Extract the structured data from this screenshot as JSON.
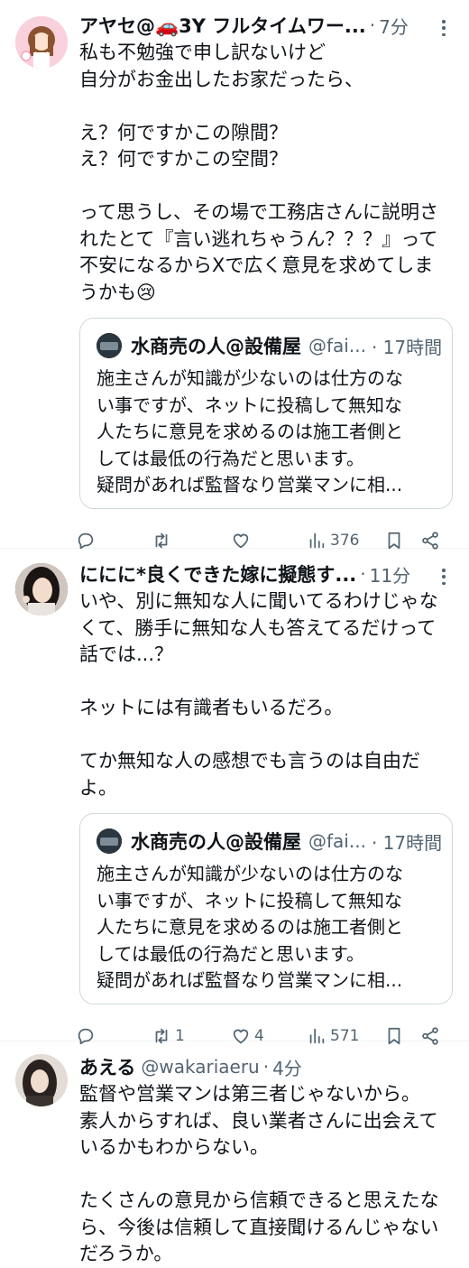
{
  "tweets": [
    {
      "name": "アヤセ@🚗3Y フルタイムワー...",
      "handle": "",
      "dot": "·",
      "time": "7分",
      "text": "私も不勉強で申し訳ないけど\n自分がお金出したお家だったら、\n\nえ？何ですかこの隙間？\nえ？何ですかこの空間？\n\nって思うし、その場で工務店さんに説明さ\nれたとて『言い逃れちゃうん？？？』って\n不安になるからXで広く意見を求めてしま\nうかも😢",
      "quote": {
        "name": "水商売の人@設備屋",
        "handle": "@fai...",
        "time": "· 17時間",
        "text": "施主さんが知識が少ないのは仕方のな\nい事ですが、ネットに投稿して無知な\n人たちに意見を求めるのは施工者側と\nしては最低の行為だと思います。\n疑問があれば監督なり営業マンに相..."
      },
      "actions": {
        "reply": "",
        "retweet": "",
        "like": "",
        "views": "376"
      }
    },
    {
      "name": "ににに*良くできた嫁に擬態す...",
      "handle": "",
      "dot": "·",
      "time": "11分",
      "text": "いや、別に無知な人に聞いてるわけじゃな\nくて、勝手に無知な人も答えてるだけって\n話では...？\n\nネットには有識者もいるだろ。\n\nてか無知な人の感想でも言うのは自由だ\nよ。",
      "quote": {
        "name": "水商売の人@設備屋",
        "handle": "@fai...",
        "time": "· 17時間",
        "text": "施主さんが知識が少ないのは仕方のな\nい事ですが、ネットに投稿して無知な\n人たちに意見を求めるのは施工者側と\nしては最低の行為だと思います。\n疑問があれば監督なり営業マンに相..."
      },
      "actions": {
        "reply": "",
        "retweet": "1",
        "like": "4",
        "views": "571"
      }
    },
    {
      "name": "あえる",
      "handle": "@wakariaeru",
      "dot": "·",
      "time": "4分",
      "text": "監督や営業マンは第三者じゃないから。\n素人からすれば、良い業者さんに出会えて\nいるかもわからない。\n\nたくさんの意見から信頼できると思えたな\nら、今後は信頼して直接聞けるんじゃない\nだろうか。"
    }
  ],
  "icons": {
    "reply": "reply-icon",
    "retweet": "retweet-icon",
    "like": "heart-icon",
    "views": "views-icon",
    "bookmark": "bookmark-icon",
    "share": "share-icon",
    "more": "more-icon"
  },
  "colors": {
    "text": "#0f1419",
    "secondary": "#536471",
    "border": "#cfd9de",
    "divider": "#eff3f4"
  }
}
